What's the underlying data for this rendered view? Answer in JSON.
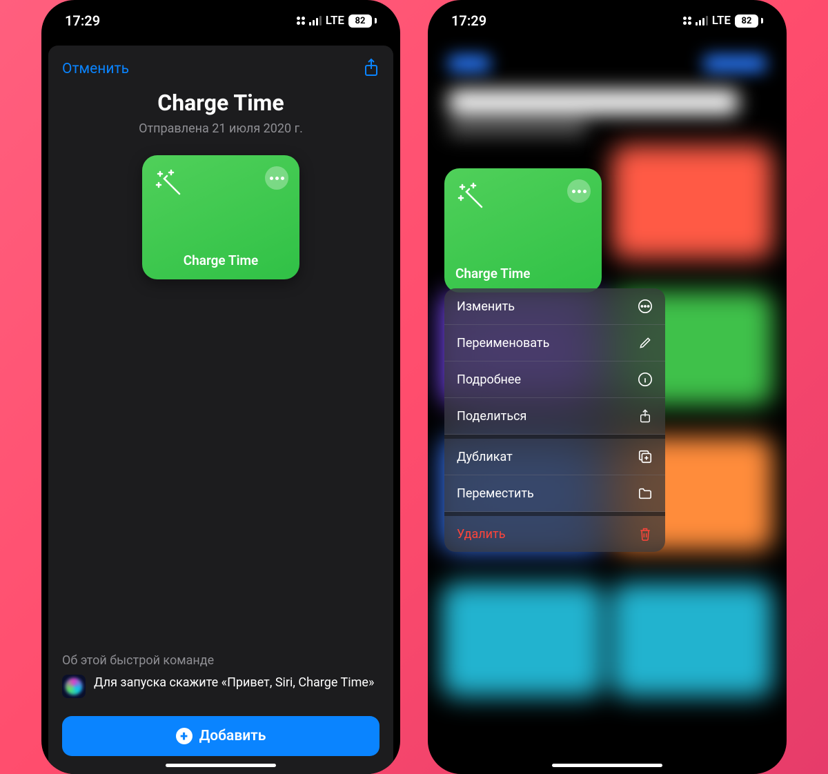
{
  "statusbar": {
    "time": "17:29",
    "network": "LTE",
    "battery": "82"
  },
  "sheet": {
    "cancel": "Отменить",
    "title": "Charge Time",
    "subtitle": "Отправлена 21 июля 2020 г.",
    "tile_label": "Charge Time",
    "about_heading": "Об этой быстрой команде",
    "siri_text": "Для запуска скажите «Привет, Siri, Charge Time»",
    "add_button": "Добавить"
  },
  "context_menu": {
    "tile_label": "Charge Time",
    "items": [
      {
        "label": "Изменить",
        "icon": "more-circle",
        "destructive": false,
        "gap": false
      },
      {
        "label": "Переименовать",
        "icon": "pencil",
        "destructive": false,
        "gap": false
      },
      {
        "label": "Подробнее",
        "icon": "info",
        "destructive": false,
        "gap": false
      },
      {
        "label": "Поделиться",
        "icon": "share",
        "destructive": false,
        "gap": false
      },
      {
        "label": "Дубликат",
        "icon": "duplicate",
        "destructive": false,
        "gap": true
      },
      {
        "label": "Переместить",
        "icon": "folder",
        "destructive": false,
        "gap": false
      },
      {
        "label": "Удалить",
        "icon": "trash",
        "destructive": true,
        "gap": true
      }
    ]
  }
}
